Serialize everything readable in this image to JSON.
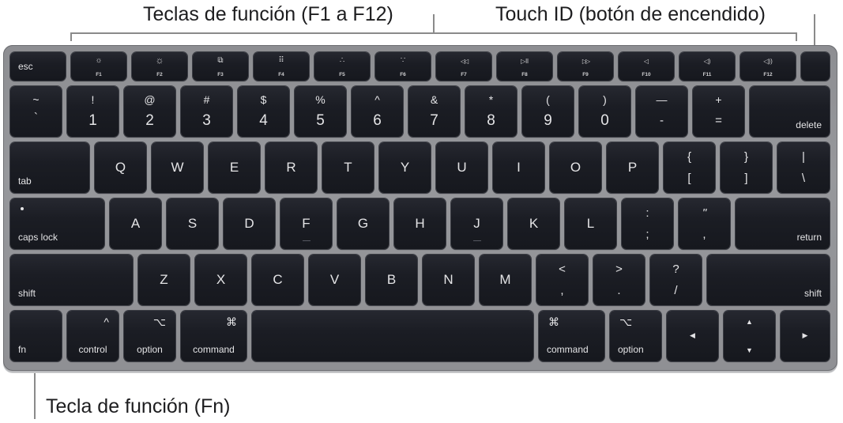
{
  "callouts": {
    "function_keys": "Teclas de función (F1 a F12)",
    "touch_id": "Touch ID (botón de encendido)",
    "fn_key": "Tecla de función (Fn)"
  },
  "function_row": [
    {
      "label": "esc"
    },
    {
      "icon": "☼",
      "label": "F1",
      "icon_name": "brightness-down-icon"
    },
    {
      "icon": "☼",
      "label": "F2",
      "icon_name": "brightness-up-icon"
    },
    {
      "icon": "⧉",
      "label": "F3",
      "icon_name": "mission-control-icon"
    },
    {
      "icon": "⠿",
      "label": "F4",
      "icon_name": "launchpad-icon"
    },
    {
      "icon": "∴",
      "label": "F5",
      "icon_name": "keyboard-backlight-down-icon"
    },
    {
      "icon": "∵",
      "label": "F6",
      "icon_name": "keyboard-backlight-up-icon"
    },
    {
      "icon": "◁◁",
      "label": "F7",
      "icon_name": "rewind-icon"
    },
    {
      "icon": "▷ll",
      "label": "F8",
      "icon_name": "play-pause-icon"
    },
    {
      "icon": "▷▷",
      "label": "F9",
      "icon_name": "fast-forward-icon"
    },
    {
      "icon": "◁",
      "label": "F10",
      "icon_name": "mute-icon"
    },
    {
      "icon": "◁)",
      "label": "F11",
      "icon_name": "volume-down-icon"
    },
    {
      "icon": "◁))",
      "label": "F12",
      "icon_name": "volume-up-icon"
    },
    {
      "label": ""
    }
  ],
  "number_row": [
    {
      "top": "~",
      "bottom": "`"
    },
    {
      "top": "!",
      "bottom": "1"
    },
    {
      "top": "@",
      "bottom": "2"
    },
    {
      "top": "#",
      "bottom": "3"
    },
    {
      "top": "$",
      "bottom": "4"
    },
    {
      "top": "%",
      "bottom": "5"
    },
    {
      "top": "^",
      "bottom": "6"
    },
    {
      "top": "&",
      "bottom": "7"
    },
    {
      "top": "*",
      "bottom": "8"
    },
    {
      "top": "(",
      "bottom": "9"
    },
    {
      "top": ")",
      "bottom": "0"
    },
    {
      "top": "—",
      "bottom": "-"
    },
    {
      "top": "+",
      "bottom": "="
    },
    {
      "label": "delete"
    }
  ],
  "qwerty_row": {
    "tab": "tab",
    "letters": [
      "Q",
      "W",
      "E",
      "R",
      "T",
      "Y",
      "U",
      "I",
      "O",
      "P"
    ],
    "pairs": [
      {
        "top": "{",
        "bottom": "["
      },
      {
        "top": "}",
        "bottom": "]"
      },
      {
        "top": "|",
        "bottom": "\\"
      }
    ]
  },
  "home_row": {
    "caps": "caps lock",
    "letters": [
      "A",
      "S",
      "D",
      "F",
      "G",
      "H",
      "J",
      "K",
      "L"
    ],
    "pairs": [
      {
        "top": ":",
        "bottom": ";"
      },
      {
        "top": "\"",
        "bottom": ","
      }
    ],
    "return": "return"
  },
  "shift_row": {
    "left_shift": "shift",
    "letters": [
      "Z",
      "X",
      "C",
      "V",
      "B",
      "N",
      "M"
    ],
    "pairs": [
      {
        "top": "<",
        "bottom": ","
      },
      {
        "top": ">",
        "bottom": "."
      },
      {
        "top": "?",
        "bottom": "/"
      }
    ],
    "right_shift": "shift"
  },
  "bottom_row": {
    "fn": "fn",
    "control": {
      "symbol": "^",
      "label": "control"
    },
    "option_left": {
      "symbol": "⌥",
      "label": "option"
    },
    "command_left": {
      "symbol": "⌘",
      "label": "command"
    },
    "command_right": {
      "symbol": "⌘",
      "label": "command"
    },
    "option_right": {
      "symbol": "⌥",
      "label": "option"
    },
    "arrows": {
      "left": "◀",
      "up": "▲",
      "down": "▼",
      "right": "▶"
    }
  }
}
